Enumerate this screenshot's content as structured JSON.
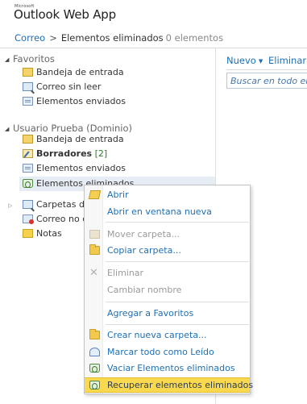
{
  "app": {
    "brand_small": "Microsoft",
    "brand_name": "Outlook Web App"
  },
  "breadcrumb": {
    "root": "Correo",
    "separator": ">",
    "current": "Elementos eliminados",
    "count": "0 elementos"
  },
  "sidebar": {
    "favorites": {
      "label": "Favoritos",
      "items": [
        {
          "label": "Bandeja de entrada",
          "icon": "inbox-icon"
        },
        {
          "label": "Correo sin leer",
          "icon": "search-folder-icon"
        },
        {
          "label": "Elementos enviados",
          "icon": "sent-icon"
        }
      ]
    },
    "mailbox": {
      "label": "Usuario Prueba (Dominio)",
      "items": [
        {
          "label": "Bandeja de entrada",
          "icon": "inbox-icon"
        },
        {
          "label": "Borradores",
          "count": "[2]",
          "icon": "drafts-icon"
        },
        {
          "label": "Elementos enviados",
          "icon": "sent-icon"
        },
        {
          "label": "Elementos eliminados",
          "icon": "recycle-icon"
        },
        {
          "label": "Carpetas de b",
          "icon": "search-folder-icon"
        },
        {
          "label": "Correo no de",
          "icon": "junk-icon"
        },
        {
          "label": "Notas",
          "icon": "notes-icon"
        }
      ]
    }
  },
  "toolbar": {
    "new_label": "Nuevo",
    "delete_label": "Eliminar",
    "search_placeholder": "Buscar en todo el b"
  },
  "context_menu": {
    "items": [
      {
        "label": "Abrir",
        "enabled": true,
        "icon": "open-folder-icon"
      },
      {
        "label": "Abrir en ventana nueva",
        "enabled": true,
        "icon": ""
      },
      {
        "label": "Mover carpeta...",
        "enabled": false,
        "icon": "move-folder-icon"
      },
      {
        "label": "Copiar carpeta...",
        "enabled": true,
        "icon": "copy-folder-icon"
      },
      {
        "label": "Eliminar",
        "enabled": false,
        "icon": "delete-x-icon"
      },
      {
        "label": "Cambiar nombre",
        "enabled": false,
        "icon": ""
      },
      {
        "label": "Agregar a Favoritos",
        "enabled": true,
        "icon": ""
      },
      {
        "label": "Crear nueva carpeta...",
        "enabled": true,
        "icon": "new-folder-icon"
      },
      {
        "label": "Marcar todo como Leído",
        "enabled": true,
        "icon": "mark-read-icon"
      },
      {
        "label": "Vaciar Elementos eliminados",
        "enabled": true,
        "icon": "empty-recycle-icon"
      },
      {
        "label": "Recuperar elementos eliminados",
        "enabled": true,
        "highlighted": true,
        "icon": "recover-icon"
      }
    ]
  },
  "colors": {
    "link": "#1e6fb5",
    "highlight": "#fbd94e",
    "selection": "#e7edf5",
    "disabled": "#9a9a9a"
  }
}
